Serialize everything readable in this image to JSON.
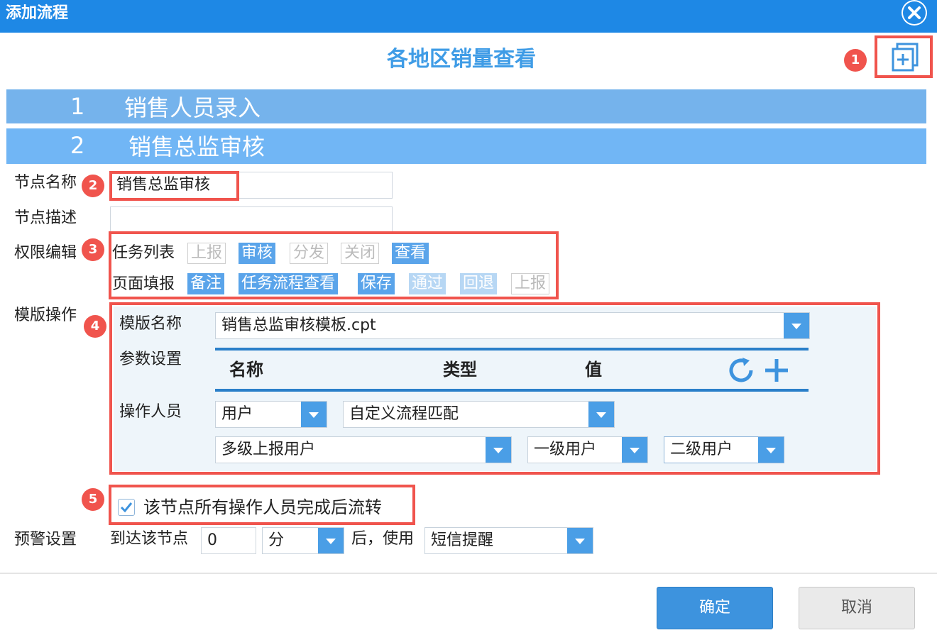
{
  "window": {
    "title": "添加流程"
  },
  "flow": {
    "title": "各地区销量查看"
  },
  "steps": [
    {
      "num": "1",
      "name": "销售人员录入"
    },
    {
      "num": "2",
      "name": "销售总监审核"
    }
  ],
  "badges": [
    "1",
    "2",
    "3",
    "4",
    "5"
  ],
  "form": {
    "node_name_label": "节点名称",
    "node_name_value": "销售总监审核",
    "node_desc_label": "节点描述",
    "node_desc_value": "",
    "perm_label": "权限编辑",
    "task_list_label": "任务列表",
    "task_list_tags": [
      {
        "text": "上报",
        "state": "off"
      },
      {
        "text": "审核",
        "state": "on"
      },
      {
        "text": "分发",
        "state": "off"
      },
      {
        "text": "关闭",
        "state": "off"
      },
      {
        "text": "查看",
        "state": "on"
      }
    ],
    "page_fill_label": "页面填报",
    "page_fill_tags": [
      {
        "text": "备注",
        "state": "on"
      },
      {
        "text": "任务流程查看",
        "state": "on"
      },
      {
        "text": "保存",
        "state": "on"
      },
      {
        "text": "通过",
        "state": "soft"
      },
      {
        "text": "回退",
        "state": "soft"
      },
      {
        "text": "上报",
        "state": "off"
      }
    ],
    "template_op_label": "模版操作"
  },
  "template": {
    "name_label": "模版名称",
    "name_value": "销售总监审核模板.cpt",
    "param_label": "参数设置",
    "col_name": "名称",
    "col_type": "类型",
    "col_value": "值",
    "operator_label": "操作人员",
    "operator_type": "用户",
    "match_mode": "自定义流程匹配",
    "level_report": "多级上报用户",
    "level1": "一级用户",
    "level2": "二级用户"
  },
  "complete": {
    "checked": true,
    "label": "该节点所有操作人员完成后流转"
  },
  "warning": {
    "label": "预警设置",
    "prefix": "到达该节点",
    "amount": "0",
    "unit": "分",
    "suffix": "后，使用",
    "method": "短信提醒"
  },
  "buttons": {
    "ok": "确定",
    "cancel": "取消"
  },
  "colors": {
    "accent": "#1e88e5",
    "step_bar": "#71b6f5",
    "highlight": "#f0544d",
    "tag_on": "#5aa4ea"
  }
}
